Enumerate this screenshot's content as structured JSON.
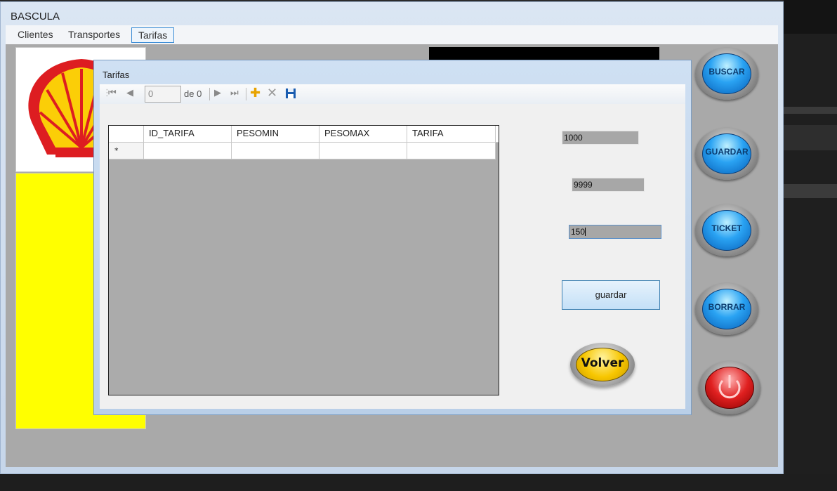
{
  "window": {
    "title": "BASCULA"
  },
  "menu": {
    "items": [
      "Clientes",
      "Transportes",
      "Tarifas"
    ],
    "active": "Tarifas"
  },
  "side_buttons": {
    "buscar": "BUSCAR",
    "guardar": "GUARDAR",
    "ticket": "TICKET",
    "borrar": "BORRAR"
  },
  "dialog": {
    "title": "Tarifas",
    "navigator": {
      "position": "0",
      "of_label": "de 0"
    },
    "grid": {
      "columns": [
        "ID_TARIFA",
        "PESOMIN",
        "PESOMAX",
        "TARIFA"
      ],
      "new_row_marker": "*"
    },
    "fields": {
      "pesomin": "1000",
      "pesomax": "9999",
      "tarifa": "150"
    },
    "save_label": "guardar",
    "back_label": "Volver"
  },
  "colors": {
    "accent_blue": "#2aa3f3",
    "back_yellow": "#f7c600",
    "power_red": "#e02020",
    "panel_yellow": "#ffff00"
  }
}
